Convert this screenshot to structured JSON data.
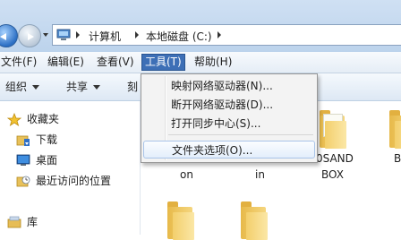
{
  "breadcrumb": [
    "计算机",
    "本地磁盘 (C:)"
  ],
  "menubar": [
    {
      "label": "文件(F)"
    },
    {
      "label": "编辑(E)"
    },
    {
      "label": "查看(V)"
    },
    {
      "label": "工具(T)",
      "active": true
    },
    {
      "label": "帮助(H)"
    }
  ],
  "toolbar": {
    "organize": "组织",
    "share": "共享",
    "truncated": "刻"
  },
  "nav": {
    "favorites": "收藏夹",
    "downloads": "下载",
    "desktop": "桌面",
    "recent": "最近访问的位置",
    "libraries": "库"
  },
  "tools_menu": {
    "items": [
      "映射网络驱动器(N)...",
      "断开网络驱动器(D)...",
      "打开同步中心(S)...",
      "文件夹选项(O)..."
    ]
  },
  "content": {
    "labels": [
      "on",
      "in",
      "0SAND",
      "BOX",
      "B"
    ]
  },
  "colors": {
    "menu_active_bg": "#3d6fb6",
    "highlight_border": "#a8c4e8",
    "folder_yellow": "#f3cf6c"
  },
  "icons": [
    "back-arrow-icon",
    "forward-arrow-icon",
    "computer-icon",
    "star-icon",
    "downloads-folder-icon",
    "desktop-icon",
    "recent-places-icon",
    "library-icon",
    "folder-icon"
  ]
}
